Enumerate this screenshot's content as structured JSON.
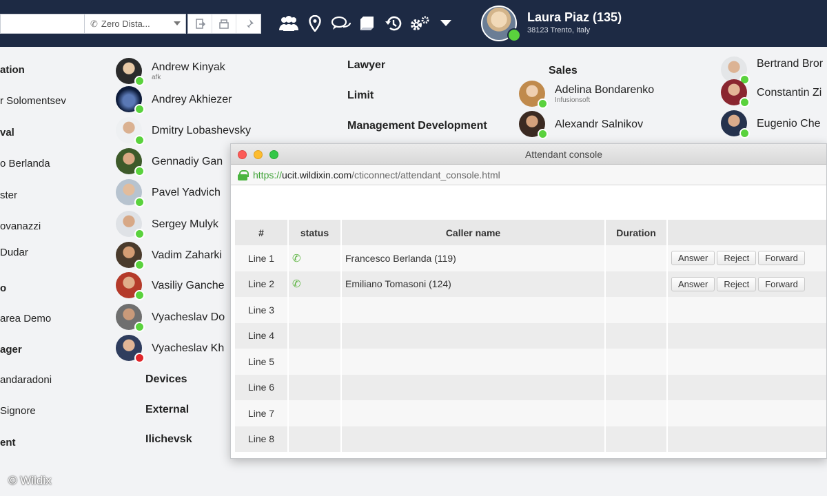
{
  "topbar": {
    "phone_select": "Zero Dista...",
    "user_name": "Laura Piaz (135)",
    "user_location": "38123 Trento, Italy"
  },
  "left_column": [
    {
      "label": "ation",
      "bold": true
    },
    {
      "label": "r Solomentsev",
      "bold": false
    },
    {
      "label": "val",
      "bold": true
    },
    {
      "label": "o Berlanda",
      "bold": false
    },
    {
      "label": "ster",
      "bold": false
    },
    {
      "label": "ovanazzi",
      "bold": false
    },
    {
      "label": "Dudar",
      "bold": false
    },
    {
      "label": "o",
      "bold": true
    },
    {
      "label": "area Demo",
      "bold": false
    },
    {
      "label": "ager",
      "bold": true
    },
    {
      "label": "andaradoni",
      "bold": false
    },
    {
      "label": "Signore",
      "bold": false
    },
    {
      "label": "ent",
      "bold": true
    }
  ],
  "contacts_col2": [
    {
      "name": "Andrew Kinyak",
      "sub": "afk"
    },
    {
      "name": "Andrey Akhiezer",
      "sub": ""
    },
    {
      "name": "Dmitry Lobashevsky",
      "sub": ""
    },
    {
      "name": "Gennadiy Gan",
      "sub": ""
    },
    {
      "name": "Pavel Yadvich",
      "sub": ""
    },
    {
      "name": "Sergey Mulyk",
      "sub": ""
    },
    {
      "name": "Vadim Zaharki",
      "sub": ""
    },
    {
      "name": "Vasiliy Ganche",
      "sub": ""
    },
    {
      "name": "Vyacheslav Do",
      "sub": ""
    },
    {
      "name": "Vyacheslav Kh",
      "sub": ""
    }
  ],
  "groups_col2": [
    "Devices",
    "External",
    "Ilichevsk"
  ],
  "groups_col3": [
    "Lawyer",
    "Limit",
    "Management Development"
  ],
  "sales": {
    "title": "Sales",
    "contacts": [
      {
        "name": "Adelina Bondarenko",
        "sub": "Infusionsoft"
      },
      {
        "name": "Alexandr Salnikov",
        "sub": ""
      }
    ]
  },
  "contacts_col5": [
    {
      "name": "Bertrand Bror"
    },
    {
      "name": "Constantin Zi"
    },
    {
      "name": "Eugenio Che"
    }
  ],
  "console": {
    "window_title": "Attendant console",
    "url_scheme": "https://",
    "url_host": "ucit.wildixin.com",
    "url_path": "/cticonnect/attendant_console.html",
    "columns": [
      "#",
      "status",
      "Caller name",
      "Duration",
      ""
    ],
    "actions": {
      "answer": "Answer",
      "reject": "Reject",
      "forward": "Forward"
    },
    "lines": [
      {
        "line": "Line 1",
        "active": true,
        "caller": "Francesco Berlanda (119)",
        "duration": ""
      },
      {
        "line": "Line 2",
        "active": true,
        "caller": "Emiliano Tomasoni (124)",
        "duration": ""
      },
      {
        "line": "Line 3",
        "active": false,
        "caller": "",
        "duration": ""
      },
      {
        "line": "Line 4",
        "active": false,
        "caller": "",
        "duration": ""
      },
      {
        "line": "Line 5",
        "active": false,
        "caller": "",
        "duration": ""
      },
      {
        "line": "Line 6",
        "active": false,
        "caller": "",
        "duration": ""
      },
      {
        "line": "Line 7",
        "active": false,
        "caller": "",
        "duration": ""
      },
      {
        "line": "Line 8",
        "active": false,
        "caller": "",
        "duration": ""
      }
    ]
  },
  "credit": "© Wildix"
}
